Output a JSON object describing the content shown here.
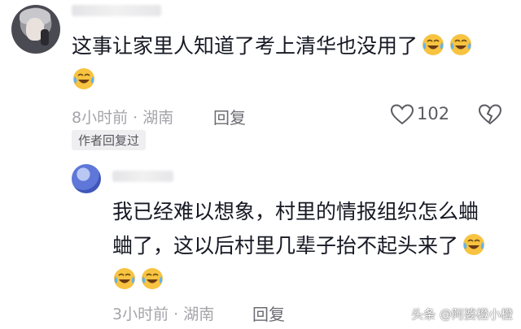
{
  "comment": {
    "text": "这事让家里人知道了考上清华也没用了",
    "time_location": "8小时前 · 湖南",
    "reply_label": "回复",
    "like_count": "102",
    "author_tag": "作者回复过"
  },
  "reply": {
    "line1": "我已经难以想象，村里的情报组织怎么蛐",
    "line2": "蛐了，这以后村里几辈子抬不起头来了",
    "time_location": "3小时前 · 湖南",
    "reply_label": "回复"
  },
  "watermark": "头条 @阿婆橙小橙",
  "icons": {
    "emoji": "crying-laughing-emoji",
    "like": "heart-outline-icon",
    "dislike": "broken-heart-icon"
  },
  "colors": {
    "text": "#161823",
    "meta": "#a4a4a9",
    "emoji_face": "#f7c341"
  }
}
